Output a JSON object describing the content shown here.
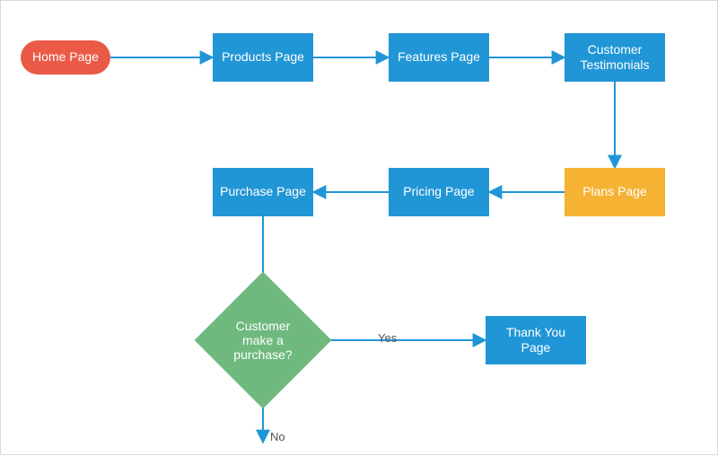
{
  "nodes": {
    "home": "Home Page",
    "products": "Products Page",
    "features": "Features Page",
    "testimonials": "Customer Testimonials",
    "plans": "Plans Page",
    "pricing": "Pricing Page",
    "purchase": "Purchase Page",
    "decision": "Customer make a purchase?",
    "thankyou": "Thank You  Page"
  },
  "edge_labels": {
    "yes": "Yes",
    "no": "No"
  },
  "colors": {
    "start": "#ea5a47",
    "process": "#2196d6",
    "plans": "#f5b233",
    "decision": "#6fb97f",
    "arrow": "#2196d6"
  }
}
